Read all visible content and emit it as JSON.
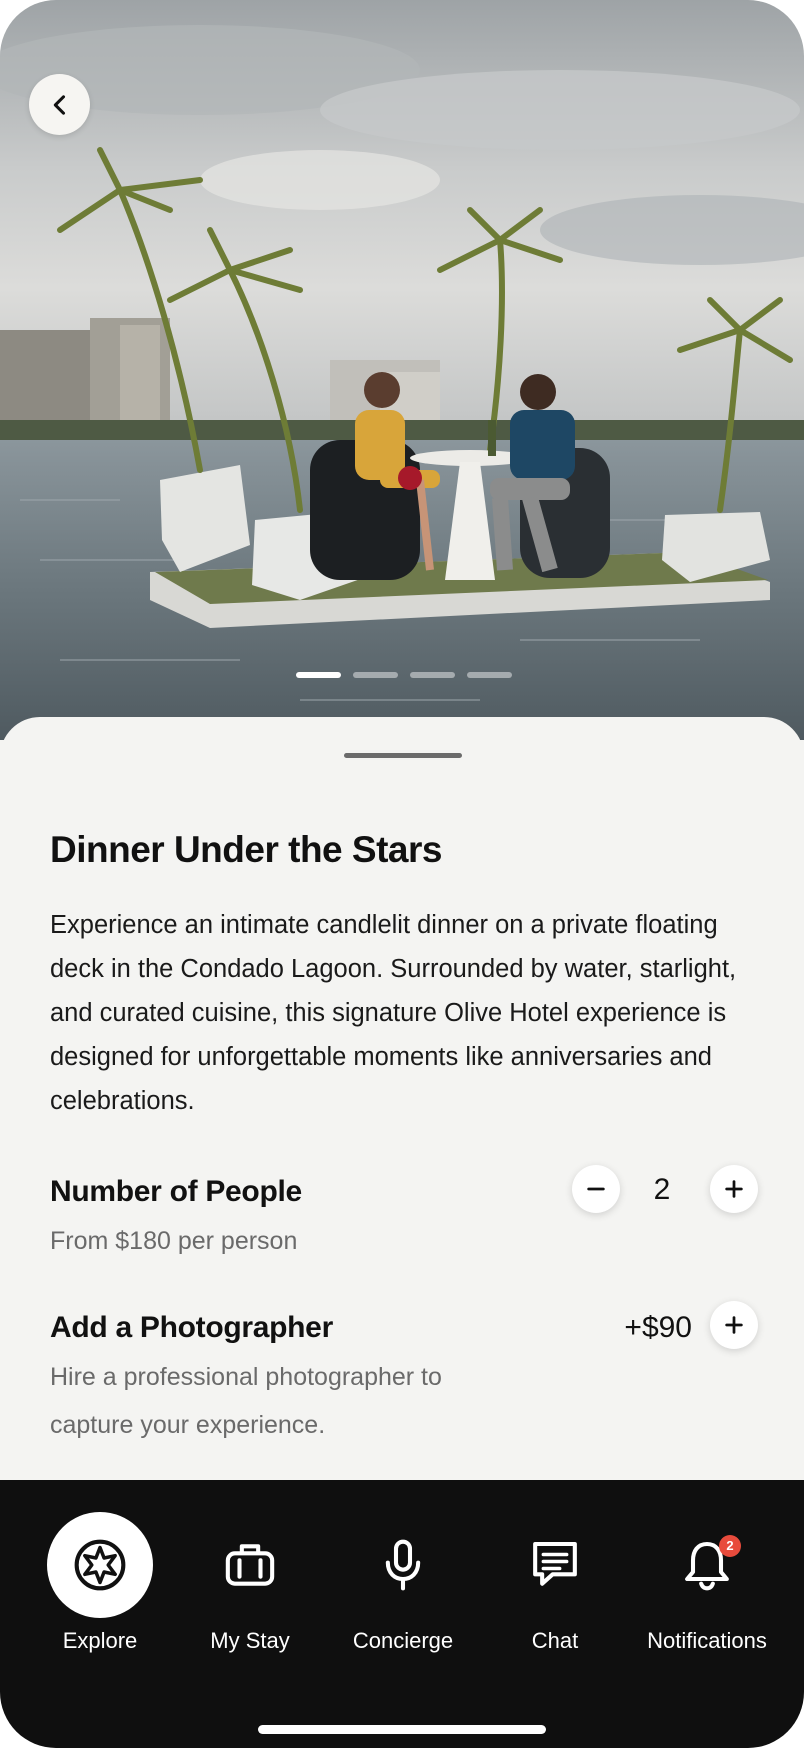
{
  "hero": {
    "back_icon": "chevron-left-icon",
    "carousel": {
      "total": 4,
      "active_index": 0
    }
  },
  "experience": {
    "title": "Dinner Under the Stars",
    "description": "Experience an intimate candlelit dinner on a private floating deck in the Condado Lagoon. Surrounded by water, starlight, and curated cuisine, this signature Olive Hotel experience is designed for unforgettable moments like anniversaries and celebrations."
  },
  "people": {
    "label": "Number of People",
    "price_note": "From $180 per person",
    "count": "2",
    "decrease_icon": "minus-icon",
    "increase_icon": "plus-icon"
  },
  "photographer": {
    "label": "Add a Photographer",
    "description": "Hire a professional photographer to capture your experience.",
    "price": "+$90",
    "add_icon": "plus-icon"
  },
  "nav": {
    "items": [
      {
        "label": "Explore",
        "icon": "compass-star-icon",
        "active": true
      },
      {
        "label": "My Stay",
        "icon": "suitcase-icon",
        "active": false
      },
      {
        "label": "Concierge",
        "icon": "microphone-icon",
        "active": false
      },
      {
        "label": "Chat",
        "icon": "chat-bubble-icon",
        "active": false
      },
      {
        "label": "Notifications",
        "icon": "bell-icon",
        "active": false,
        "badge": "2"
      }
    ]
  },
  "colors": {
    "background": "#f4f4f2",
    "nav_background": "#0f0f0f",
    "badge": "#e84b3c"
  }
}
